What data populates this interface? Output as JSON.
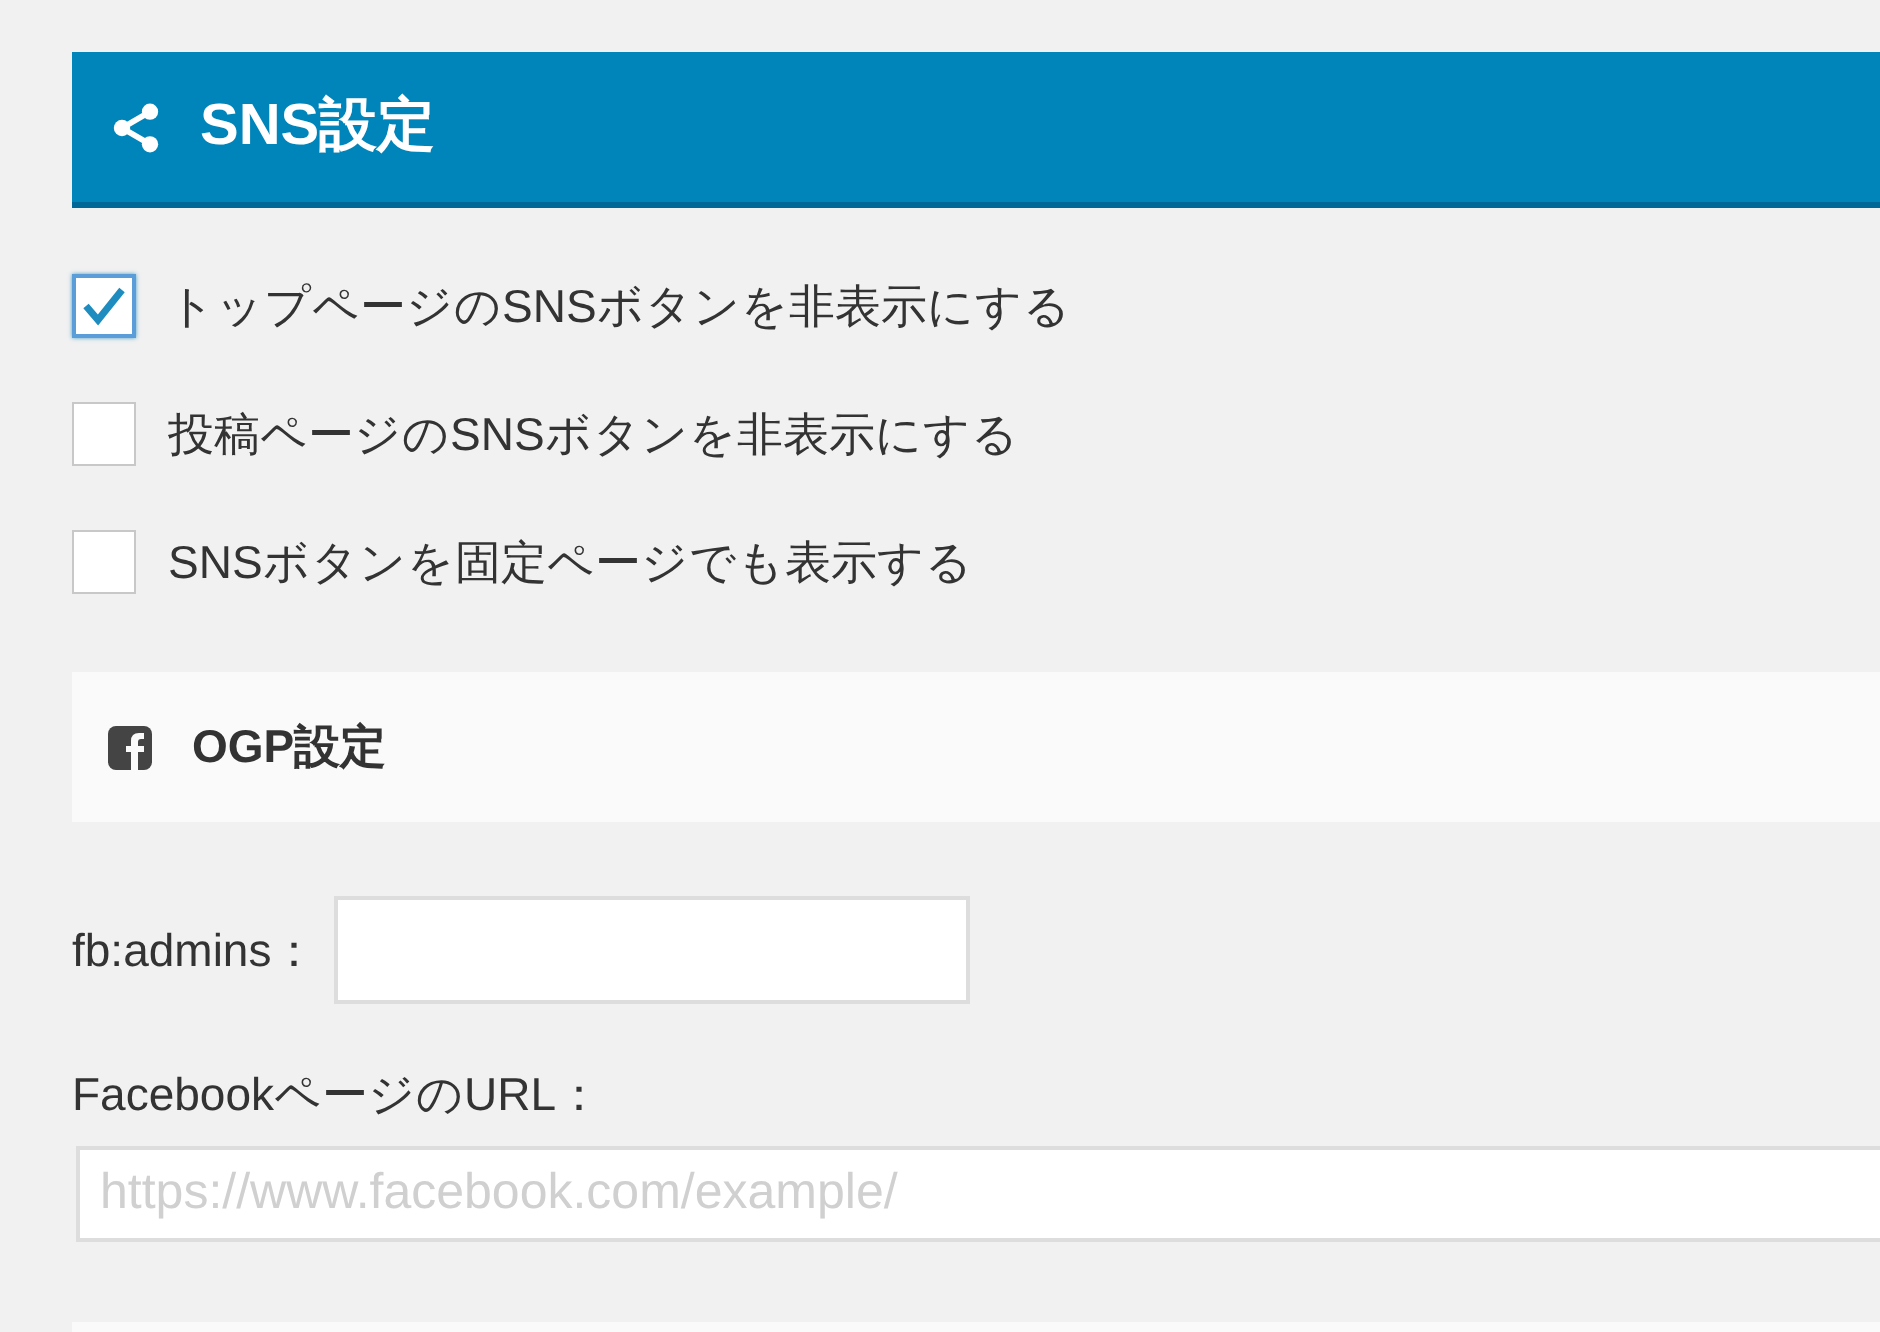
{
  "header": {
    "title": "SNS設定"
  },
  "options": [
    {
      "label": "トップページのSNSボタンを非表示にする",
      "checked": true
    },
    {
      "label": "投稿ページのSNSボタンを非表示にする",
      "checked": false
    },
    {
      "label": "SNSボタンを固定ページでも表示する",
      "checked": false
    }
  ],
  "ogp_section": {
    "title": "OGP設定"
  },
  "fb_admins": {
    "label": "fb:admins："
  },
  "facebook_url": {
    "label": "FacebookページのURL：",
    "placeholder": "https://www.facebook.com/example/"
  }
}
